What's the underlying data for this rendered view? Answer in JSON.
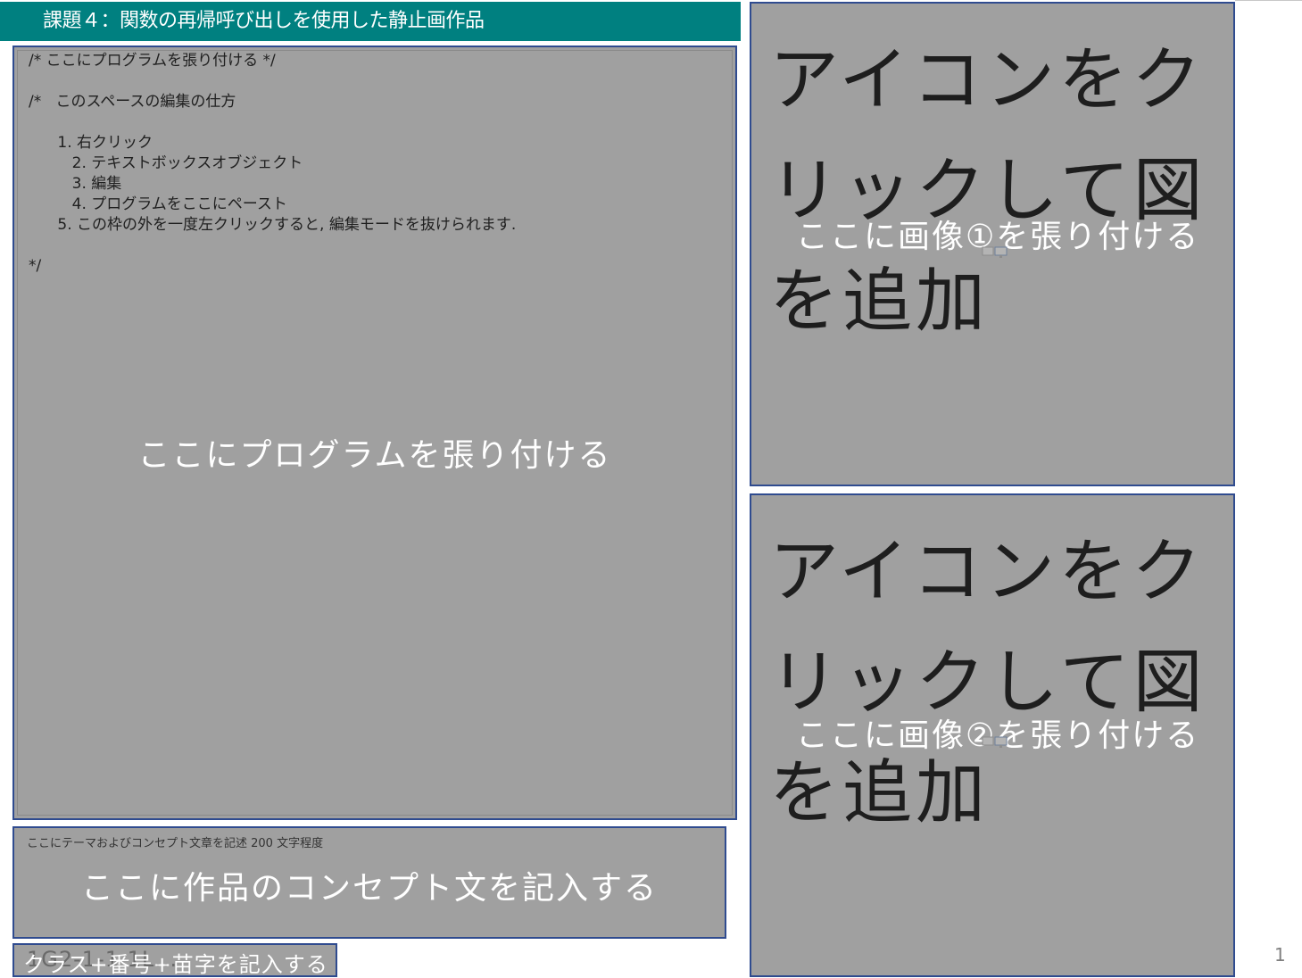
{
  "slide": {
    "title": "課題４：関数の再帰呼び出しを使用した静止画作品",
    "page_number": "1"
  },
  "code_panel": {
    "code_lines": "/* ここにプログラムを張り付ける */\n\n/*   このスペースの編集の仕方\n\n      1. 右クリック\n         2. テキストボックスオブジェクト\n         3. 編集\n         4. プログラムをここにペースト\n      5. この枠の外を一度左クリックすると, 編集モードを抜けられます.\n\n*/",
    "label": "ここにプログラムを張り付ける"
  },
  "concept_panel": {
    "hint": "ここにテーマおよびコンセプト文章を記述 200 文字程度",
    "label": "ここに作品のコンセプト文を記入する"
  },
  "class_panel": {
    "ghost_text": "1G2-1-1 1L...",
    "label": "クラス+番号+苗字を記入する"
  },
  "image_panels": [
    {
      "placeholder": "アイコンをクリックして図を追加",
      "label": "ここに画像①を張り付ける",
      "icon": "insert-picture-icon"
    },
    {
      "placeholder": "アイコンをクリックして図を追加",
      "label": "ここに画像②を張り付ける",
      "icon": "insert-picture-icon"
    }
  ],
  "colors": {
    "title_bar": "#008080",
    "panel_fill": "#a0a0a0",
    "panel_border": "#2f4b8f"
  }
}
